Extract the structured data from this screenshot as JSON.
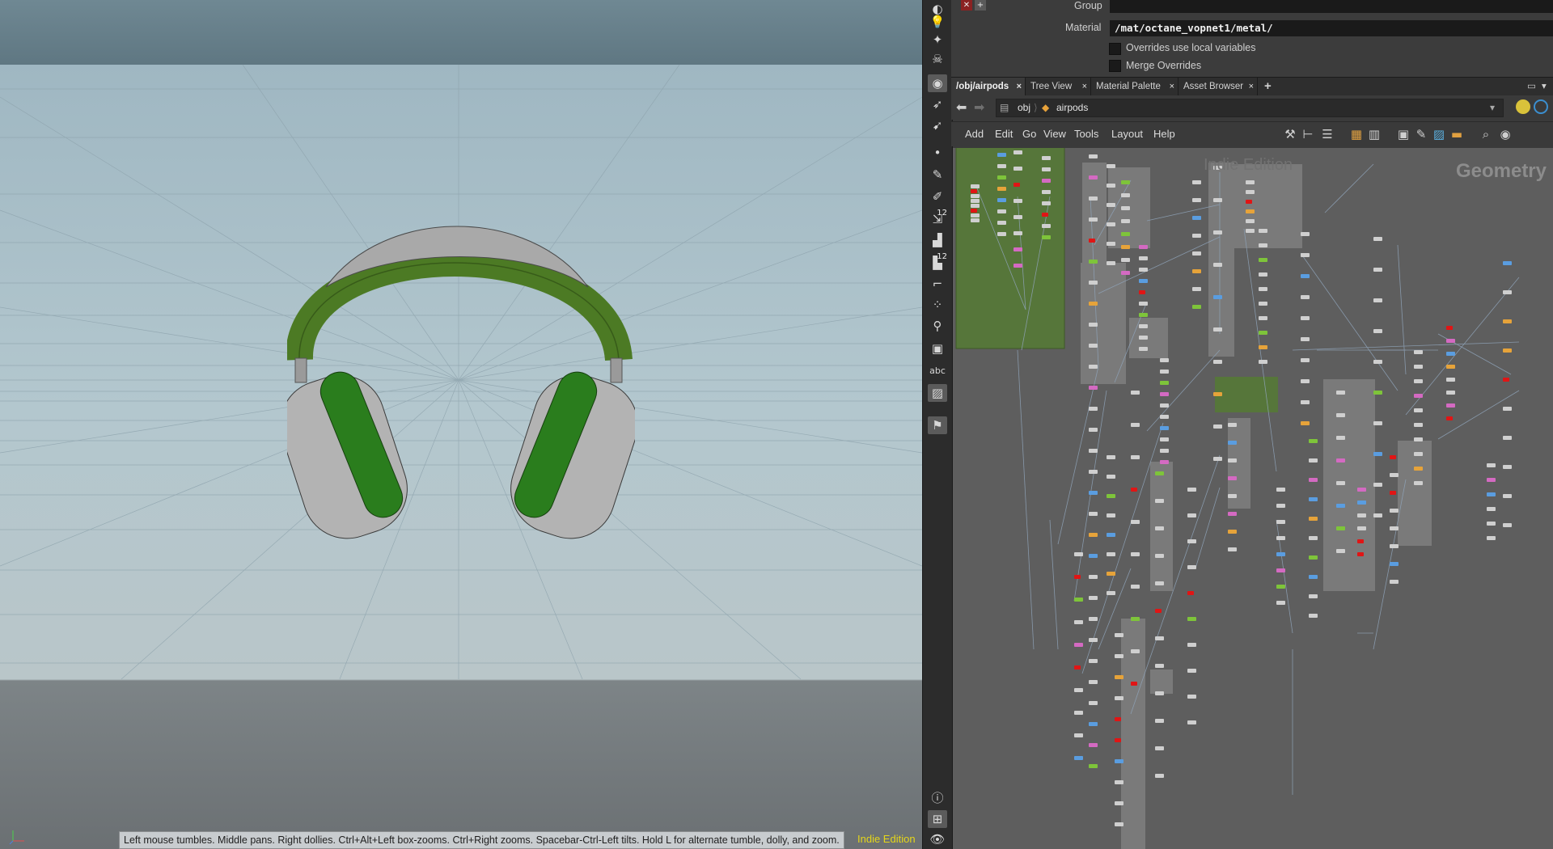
{
  "viewport": {
    "status_hint": "Left mouse tumbles. Middle pans. Right dollies. Ctrl+Alt+Left box-zooms. Ctrl+Right zooms. Spacebar-Ctrl-Left tilts. Hold L for alternate tumble, dolly, and zoom.",
    "edition_label": "Indie Edition",
    "model_colors": {
      "band_green": "#4c7a24",
      "cushion_green": "#2a7d1d",
      "shell_gray": "#b3b3b3"
    }
  },
  "shelf": {
    "tools": [
      "camera-icon",
      "light-icon",
      "light-icon",
      "skull-icon",
      "view-icon",
      "handle-icon",
      "handle-icon",
      "dot-icon",
      "brush-icon",
      "pen-icon",
      "num-icon",
      "bucket-icon",
      "num-icon",
      "curve-icon",
      "scatter-icon",
      "pin-icon",
      "box-icon",
      "text-icon",
      "image-icon",
      "marker-icon",
      "info-icon",
      "grid-icon",
      "eye-icon"
    ],
    "num_badge": "12",
    "text_tool": "abc"
  },
  "params": {
    "group_label": "Group",
    "material_label": "Material",
    "material_value": "/mat/octane_vopnet1/metal/",
    "overrides_local_label": "Overrides use local variables",
    "merge_overrides_label": "Merge Overrides"
  },
  "tabs": [
    {
      "label": "/obj/airpods",
      "active": true
    },
    {
      "label": "Tree View",
      "active": false
    },
    {
      "label": "Material Palette",
      "active": false
    },
    {
      "label": "Asset Browser",
      "active": false
    }
  ],
  "tab_add": "+",
  "tab_close": "×",
  "path": {
    "root": "obj",
    "node": "airpods"
  },
  "menus": [
    "Add",
    "Edit",
    "Go",
    "View",
    "Tools",
    "Layout",
    "Help"
  ],
  "network": {
    "watermark": "Indie Edition",
    "context_label": "Geometry",
    "colors": {
      "background": "#5e5e5e",
      "green_box": "#56763a",
      "gray_box": "#7a7a7a",
      "node": "#cfcfcf",
      "node_green": "#7ec43a",
      "node_red": "#e01515",
      "node_blue": "#5a9de0",
      "node_orange": "#e6a33a",
      "node_pink": "#d46ac2",
      "wire": "#8fa3b8"
    }
  }
}
